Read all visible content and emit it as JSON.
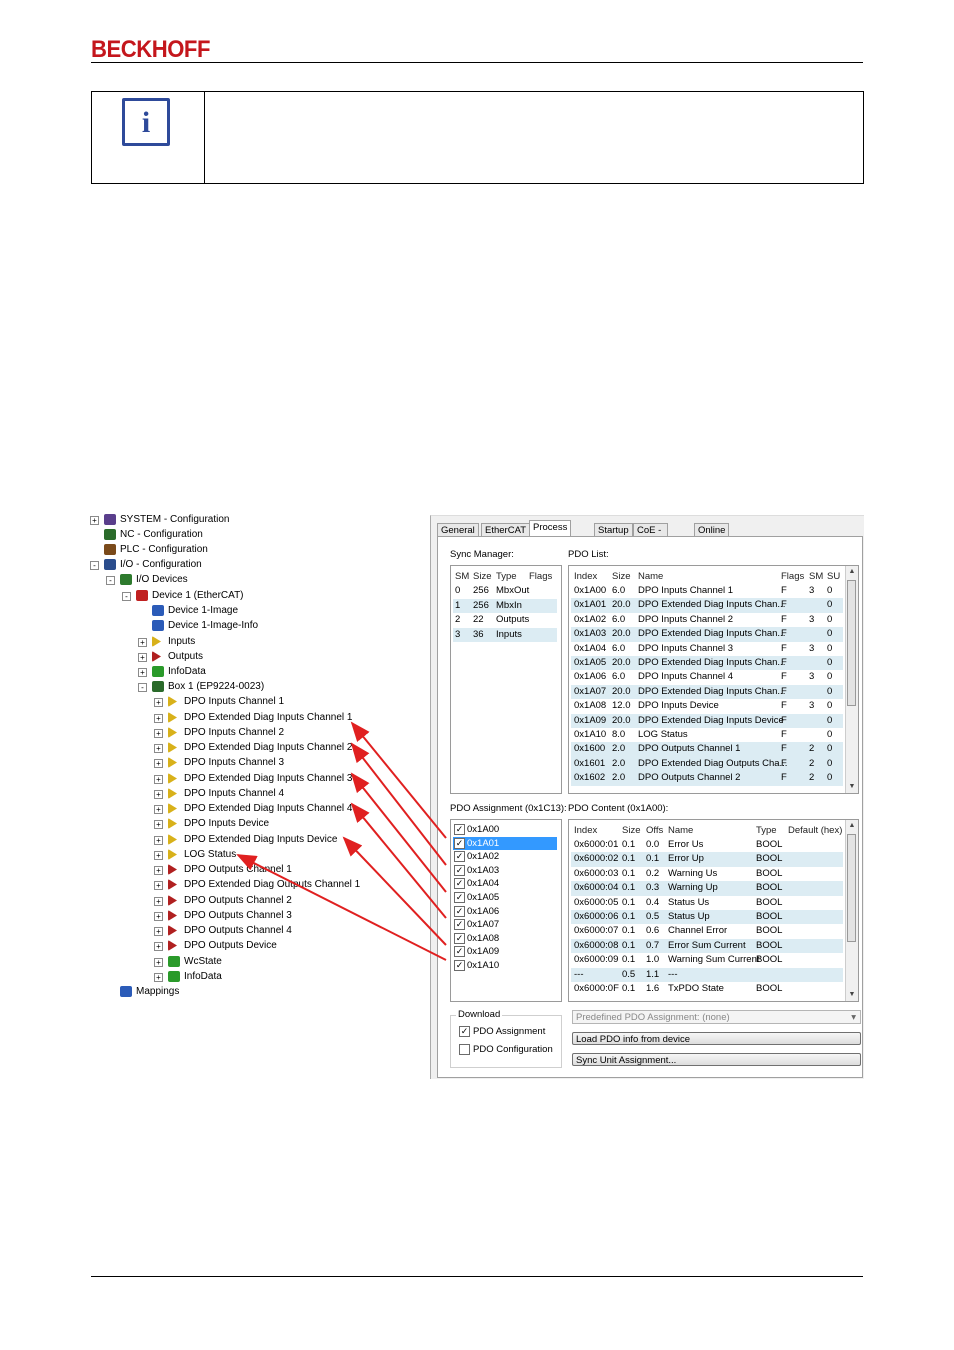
{
  "header": {
    "logo_text": "BECKHOFF",
    "brand_color": "#c4161c"
  },
  "note": {
    "icon": "info-icon",
    "icon_glyph": "i",
    "icon_color": "#2e4a9a"
  },
  "tree": {
    "items": [
      {
        "label": "SYSTEM - Configuration",
        "icon": "system-icon"
      },
      {
        "label": "NC - Configuration",
        "icon": "nc-icon"
      },
      {
        "label": "PLC - Configuration",
        "icon": "plc-icon"
      },
      {
        "label": "I/O - Configuration",
        "icon": "io-icon"
      },
      {
        "label": "I/O Devices",
        "icon": "io-devices-icon"
      },
      {
        "label": "Device 1 (EtherCAT)",
        "icon": "ethercat-device-icon"
      },
      {
        "label": "Device 1-Image",
        "icon": "image-icon"
      },
      {
        "label": "Device 1-Image-Info",
        "icon": "image-icon"
      },
      {
        "label": "Inputs",
        "icon": "inputs-icon"
      },
      {
        "label": "Outputs",
        "icon": "outputs-icon"
      },
      {
        "label": "InfoData",
        "icon": "infodata-icon"
      },
      {
        "label": "Box 1 (EP9224-0023)",
        "icon": "box-icon"
      },
      {
        "label": "DPO Inputs Channel 1",
        "icon": "input-pdo-icon"
      },
      {
        "label": "DPO Extended Diag Inputs Channel 1",
        "icon": "input-pdo-icon"
      },
      {
        "label": "DPO Inputs Channel 2",
        "icon": "input-pdo-icon"
      },
      {
        "label": "DPO Extended Diag Inputs Channel 2",
        "icon": "input-pdo-icon"
      },
      {
        "label": "DPO Inputs Channel 3",
        "icon": "input-pdo-icon"
      },
      {
        "label": "DPO Extended Diag Inputs Channel 3",
        "icon": "input-pdo-icon"
      },
      {
        "label": "DPO Inputs Channel 4",
        "icon": "input-pdo-icon"
      },
      {
        "label": "DPO Extended Diag Inputs Channel 4",
        "icon": "input-pdo-icon"
      },
      {
        "label": "DPO Inputs Device",
        "icon": "input-pdo-icon"
      },
      {
        "label": "DPO Extended Diag Inputs Device",
        "icon": "input-pdo-icon"
      },
      {
        "label": "LOG Status",
        "icon": "input-pdo-icon"
      },
      {
        "label": "DPO Outputs Channel 1",
        "icon": "output-pdo-icon"
      },
      {
        "label": "DPO Extended Diag Outputs Channel 1",
        "icon": "output-pdo-icon"
      },
      {
        "label": "DPO Outputs Channel 2",
        "icon": "output-pdo-icon"
      },
      {
        "label": "DPO Outputs Channel 3",
        "icon": "output-pdo-icon"
      },
      {
        "label": "DPO Outputs Channel 4",
        "icon": "output-pdo-icon"
      },
      {
        "label": "DPO Outputs Device",
        "icon": "output-pdo-icon"
      },
      {
        "label": "WcState",
        "icon": "wcstate-icon"
      },
      {
        "label": "InfoData",
        "icon": "infodata-icon"
      },
      {
        "label": "Mappings",
        "icon": "mappings-icon"
      }
    ]
  },
  "tabs": [
    "General",
    "EtherCAT",
    "Process Data",
    "Startup",
    "CoE - Online",
    "Online"
  ],
  "sync_manager": {
    "title": "Sync Manager:",
    "headers": [
      "SM",
      "Size",
      "Type",
      "Flags"
    ],
    "rows": [
      [
        "0",
        "256",
        "MbxOut",
        ""
      ],
      [
        "1",
        "256",
        "MbxIn",
        ""
      ],
      [
        "2",
        "22",
        "Outputs",
        ""
      ],
      [
        "3",
        "36",
        "Inputs",
        ""
      ]
    ]
  },
  "pdo_list": {
    "title": "PDO List:",
    "headers": [
      "Index",
      "Size",
      "Name",
      "Flags",
      "SM",
      "SU"
    ],
    "rows": [
      [
        "0x1A00",
        "6.0",
        "DPO Inputs Channel 1",
        "F",
        "3",
        "0"
      ],
      [
        "0x1A01",
        "20.0",
        "DPO Extended Diag Inputs Chan...",
        "F",
        "",
        "0"
      ],
      [
        "0x1A02",
        "6.0",
        "DPO Inputs Channel 2",
        "F",
        "3",
        "0"
      ],
      [
        "0x1A03",
        "20.0",
        "DPO Extended Diag Inputs Chan...",
        "F",
        "",
        "0"
      ],
      [
        "0x1A04",
        "6.0",
        "DPO Inputs Channel 3",
        "F",
        "3",
        "0"
      ],
      [
        "0x1A05",
        "20.0",
        "DPO Extended Diag Inputs Chan...",
        "F",
        "",
        "0"
      ],
      [
        "0x1A06",
        "6.0",
        "DPO Inputs Channel 4",
        "F",
        "3",
        "0"
      ],
      [
        "0x1A07",
        "20.0",
        "DPO Extended Diag Inputs Chan...",
        "F",
        "",
        "0"
      ],
      [
        "0x1A08",
        "12.0",
        "DPO Inputs Device",
        "F",
        "3",
        "0"
      ],
      [
        "0x1A09",
        "20.0",
        "DPO Extended Diag Inputs Device",
        "F",
        "",
        "0"
      ],
      [
        "0x1A10",
        "8.0",
        "LOG Status",
        "F",
        "",
        "0"
      ],
      [
        "0x1600",
        "2.0",
        "DPO Outputs Channel 1",
        "F",
        "2",
        "0"
      ],
      [
        "0x1601",
        "2.0",
        "DPO Extended Diag Outputs Cha...",
        "F",
        "2",
        "0"
      ],
      [
        "0x1602",
        "2.0",
        "DPO Outputs Channel 2",
        "F",
        "2",
        "0"
      ]
    ]
  },
  "pdo_assignment": {
    "title": "PDO Assignment (0x1C13):",
    "items": [
      "0x1A00",
      "0x1A01",
      "0x1A02",
      "0x1A03",
      "0x1A04",
      "0x1A05",
      "0x1A06",
      "0x1A07",
      "0x1A08",
      "0x1A09",
      "0x1A10"
    ]
  },
  "pdo_content": {
    "title": "PDO Content (0x1A00):",
    "headers": [
      "Index",
      "Size",
      "Offs",
      "Name",
      "Type",
      "Default (hex)"
    ],
    "rows": [
      [
        "0x6000:01",
        "0.1",
        "0.0",
        "Error Us",
        "BOOL",
        ""
      ],
      [
        "0x6000:02",
        "0.1",
        "0.1",
        "Error Up",
        "BOOL",
        ""
      ],
      [
        "0x6000:03",
        "0.1",
        "0.2",
        "Warning Us",
        "BOOL",
        ""
      ],
      [
        "0x6000:04",
        "0.1",
        "0.3",
        "Warning Up",
        "BOOL",
        ""
      ],
      [
        "0x6000:05",
        "0.1",
        "0.4",
        "Status Us",
        "BOOL",
        ""
      ],
      [
        "0x6000:06",
        "0.1",
        "0.5",
        "Status Up",
        "BOOL",
        ""
      ],
      [
        "0x6000:07",
        "0.1",
        "0.6",
        "Channel Error",
        "BOOL",
        ""
      ],
      [
        "0x6000:08",
        "0.1",
        "0.7",
        "Error Sum Current",
        "BOOL",
        ""
      ],
      [
        "0x6000:09",
        "0.1",
        "1.0",
        "Warning Sum Current",
        "BOOL",
        ""
      ],
      [
        "---",
        "0.5",
        "1.1",
        "---",
        "",
        ""
      ],
      [
        "0x6000:0F",
        "0.1",
        "1.6",
        "TxPDO State",
        "BOOL",
        ""
      ]
    ]
  },
  "download": {
    "title": "Download",
    "pdo_assignment": "PDO Assignment",
    "pdo_configuration": "PDO Configuration"
  },
  "predefined": "Predefined PDO Assignment: (none)",
  "load_button": "Load PDO info from device",
  "sync_unit_button": "Sync Unit Assignment...",
  "arrow_color": "#e02020"
}
